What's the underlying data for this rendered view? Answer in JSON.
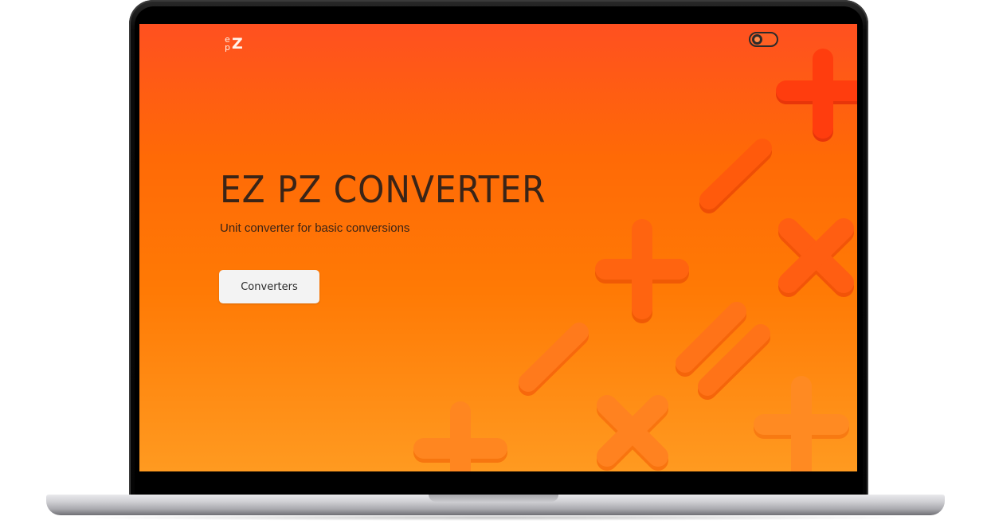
{
  "app": {
    "logo_text": "ezpz",
    "title": "EZ PZ CONVERTER",
    "subtitle": "Unit converter for basic conversions",
    "cta_label": "Converters"
  },
  "header": {
    "theme_toggle": {
      "state": "off",
      "icon": "theme-toggle-icon"
    }
  },
  "colors": {
    "gradient_top": "#ff5020",
    "gradient_bottom": "#ff9a20",
    "title_text": "#3a2417",
    "button_bg": "#f3f3f3",
    "shape_color": "#ff6e10"
  },
  "decorations": [
    "plus-icon",
    "minus-icon",
    "multiply-icon",
    "equals-icon"
  ]
}
